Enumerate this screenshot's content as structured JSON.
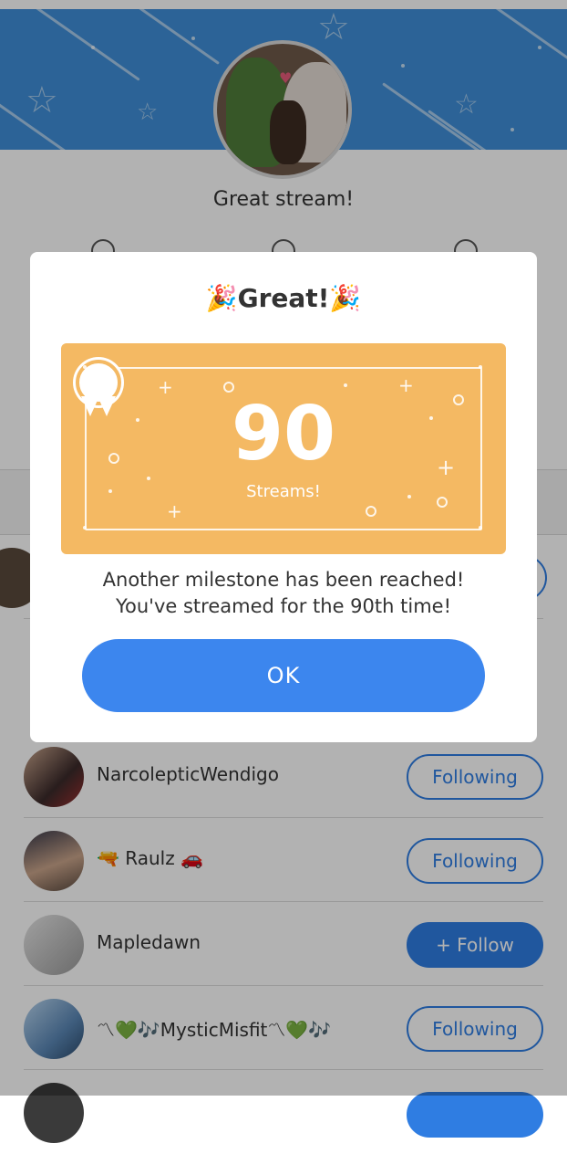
{
  "stream": {
    "title": "Great stream!"
  },
  "list": {
    "rows": [
      {
        "name": "NarcolepticWendigo",
        "button": "Following",
        "state": "following"
      },
      {
        "name": "🔫 Raulz 🚗",
        "button": "Following",
        "state": "following"
      },
      {
        "name": "Mapledawn",
        "button": "+ Follow",
        "state": "follow"
      },
      {
        "name": "〽💚🎶MysticMisfit〽💚🎶",
        "button": "Following",
        "state": "following"
      }
    ]
  },
  "modal": {
    "title": "🎉Great!🎉",
    "milestone_number": "90",
    "milestone_label": "Streams!",
    "message_line1": "Another milestone has been reached!",
    "message_line2": "You've streamed for the 90th time!",
    "ok_label": "OK"
  },
  "colors": {
    "banner": "#3f8fd8",
    "certificate": "#f4b963",
    "primary": "#2f7de2",
    "ok_button": "#3c86ee"
  }
}
